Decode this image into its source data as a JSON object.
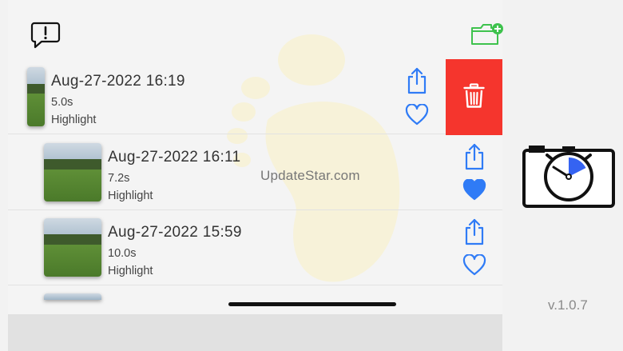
{
  "app": {
    "watermark": "UpdateStar.com",
    "version": "v.1.0.7"
  },
  "toolbar": {
    "feedback_icon": "exclamation-speech-bubble-icon",
    "new_folder_icon": "folder-plus-icon"
  },
  "clips": [
    {
      "date": "Aug-27-2022 16:19",
      "duration": "5.0s",
      "label": "Highlight",
      "favorite": false
    },
    {
      "date": "Aug-27-2022 16:11",
      "duration": "7.2s",
      "label": "Highlight",
      "favorite": true
    },
    {
      "date": "Aug-27-2022 15:59",
      "duration": "10.0s",
      "label": "Highlight",
      "favorite": false
    }
  ],
  "colors": {
    "accent": "#2f7bf6",
    "delete": "#f5352d",
    "folder_green": "#3ec24d"
  }
}
